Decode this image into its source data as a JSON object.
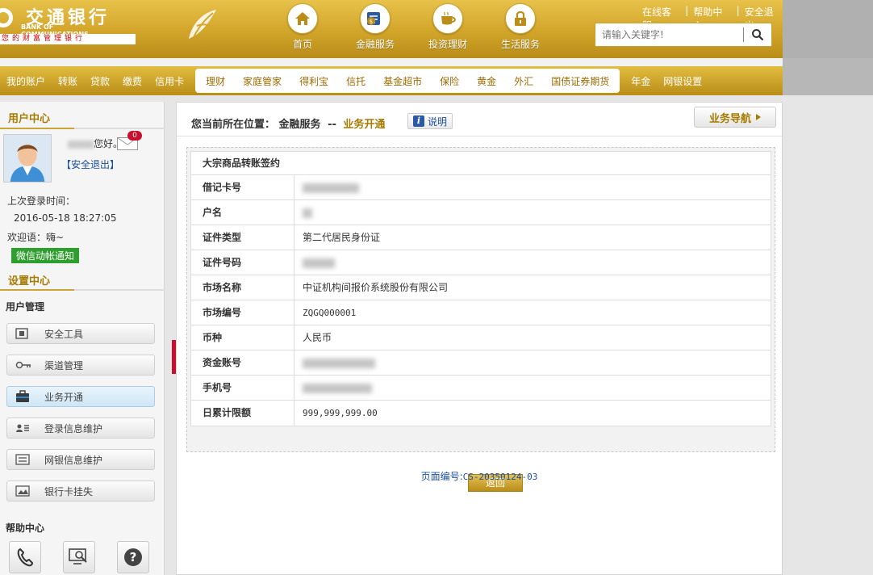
{
  "brand": {
    "name_cn": "交通银行",
    "name_en_line1": "BANK OF",
    "name_en_line2": "COMMUNICATIONS",
    "slogan": "您的财富管理银行",
    "color_gold": "#d4a72c",
    "color_red": "#c8102e"
  },
  "top_nav": [
    {
      "label": "首页",
      "icon": "home-icon"
    },
    {
      "label": "金融服务",
      "icon": "finance-icon"
    },
    {
      "label": "投资理财",
      "icon": "coffee-icon"
    },
    {
      "label": "生活服务",
      "icon": "lock-icon"
    }
  ],
  "top_links": {
    "service": "在线客服",
    "help": "帮助中心",
    "logout": "安全退出"
  },
  "search": {
    "placeholder": "请输入关键字!"
  },
  "sub_nav": {
    "left": [
      "我的账户",
      "转账",
      "贷款",
      "缴费",
      "信用卡"
    ],
    "pill": [
      "理财",
      "家庭管家",
      "得利宝",
      "信托",
      "基金超市",
      "保险",
      "黄金",
      "外汇",
      "国债证券期货"
    ],
    "right": [
      "年金",
      "网银设置"
    ]
  },
  "sidebar": {
    "user_center_title": "用户中心",
    "greeting_suffix": "您好。",
    "mail_count": "0",
    "logout": "【安全退出】",
    "last_login_label": "上次登录时间：",
    "last_login_value": "2016-05-18 18:27:05",
    "welcome": "欢迎语：嗨~",
    "wechat": "微信动帐通知",
    "settings_title": "设置中心",
    "user_mgmt": "用户管理",
    "menu": [
      {
        "label": "安全工具",
        "icon": "safe-icon"
      },
      {
        "label": "渠道管理",
        "icon": "key-icon"
      },
      {
        "label": "业务开通",
        "icon": "briefcase-icon"
      },
      {
        "label": "登录信息维护",
        "icon": "id-card-icon"
      },
      {
        "label": "网银信息维护",
        "icon": "list-card-icon"
      },
      {
        "label": "银行卡挂失",
        "icon": "picture-icon"
      }
    ],
    "help_title": "帮助中心",
    "help_icons": [
      "phone-icon",
      "search-monitor-icon",
      "question-icon"
    ]
  },
  "main": {
    "crumb_label": "您当前所在位置：",
    "crumb_parent": "金融服务",
    "crumb_sep": "--",
    "crumb_current": "业务开通",
    "info_label": "说明",
    "guide_label": "业务导航",
    "panel_title": "大宗商品转账签约",
    "rows": [
      {
        "key": "借记卡号",
        "value": ""
      },
      {
        "key": "户名",
        "value": ""
      },
      {
        "key": "证件类型",
        "value": "第二代居民身份证"
      },
      {
        "key": "证件号码",
        "value": ""
      },
      {
        "key": "市场名称",
        "value": "中证机构间报价系统股份有限公司"
      },
      {
        "key": "市场编号",
        "value": "ZQGQ000001"
      },
      {
        "key": "币种",
        "value": "人民币"
      },
      {
        "key": "资金账号",
        "value": ""
      },
      {
        "key": "手机号",
        "value": ""
      },
      {
        "key": "日累计限额",
        "value": "999,999,999.00"
      }
    ],
    "back_label": "返回",
    "page_no_label": "页面编号:",
    "page_no_value": "CS-20350124-03"
  }
}
